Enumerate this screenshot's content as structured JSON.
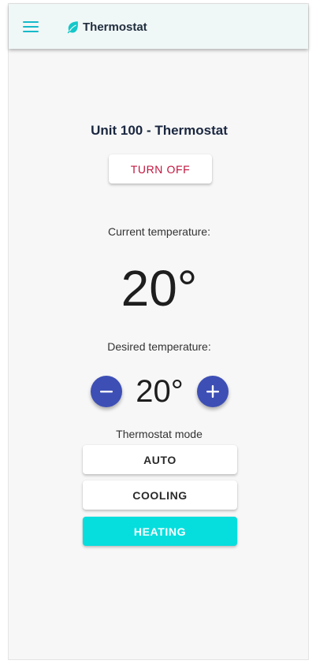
{
  "app": {
    "title": "Thermostat",
    "icons": {
      "menu": "menu-icon",
      "brand": "leaf-icon",
      "decrease": "minus-icon",
      "increase": "plus-icon"
    },
    "colors": {
      "accent": "#14b9c9",
      "primary_button": "#3d4fb5",
      "turn_off_text": "#c2143d",
      "active_mode": "#06dede"
    }
  },
  "thermostat": {
    "unit_title": "Unit 100 - Thermostat",
    "power_button_label": "TURN OFF",
    "current_label": "Current temperature:",
    "current_value": "20°",
    "desired_label": "Desired temperature:",
    "desired_value": "20°",
    "mode_label": "Thermostat mode",
    "modes": [
      {
        "label": "AUTO",
        "active": false
      },
      {
        "label": "COOLING",
        "active": false
      },
      {
        "label": "HEATING",
        "active": true
      }
    ]
  }
}
